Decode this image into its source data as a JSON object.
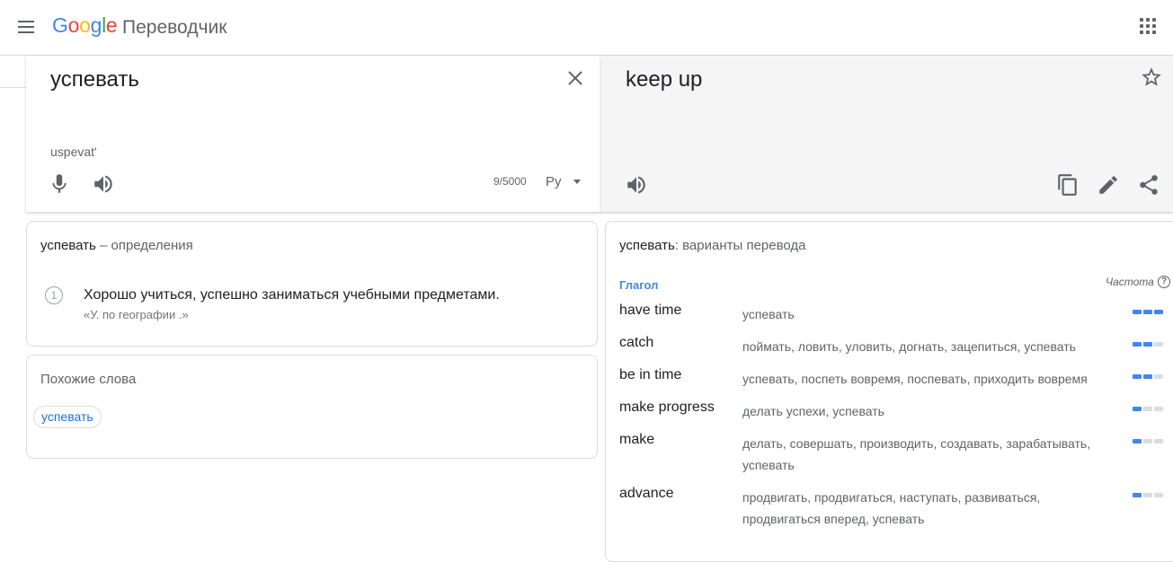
{
  "header": {
    "logo_parts": [
      "G",
      "o",
      "o",
      "g",
      "l",
      "e"
    ],
    "product": "Переводчик"
  },
  "source": {
    "text": "успевать",
    "transliteration": "uspevat'",
    "char_count": "9/5000",
    "ime_label": "Ру"
  },
  "target": {
    "text": "keep up"
  },
  "definitions": {
    "word": "успевать",
    "suffix": " – определения",
    "items": [
      {
        "number": "1",
        "text": "Хорошо учиться, успешно заниматься учебными предметами.",
        "example": "«У. по географии .»"
      }
    ]
  },
  "related": {
    "title": "Похожие слова",
    "chips": [
      "успевать"
    ]
  },
  "variants": {
    "word": "успевать",
    "suffix": ": варианты перевода",
    "pos": "Глагол",
    "frequency_label": "Частота",
    "help": "?",
    "rows": [
      {
        "word": "have time",
        "synonyms": "успевать",
        "frequency": 3
      },
      {
        "word": "catch",
        "synonyms": "поймать, ловить, уловить, догнать, зацепиться, успевать",
        "frequency": 2
      },
      {
        "word": "be in time",
        "synonyms": "успевать, поспеть вовремя, поспевать, приходить вовремя",
        "frequency": 2
      },
      {
        "word": "make progress",
        "synonyms": "делать успехи, успевать",
        "frequency": 1
      },
      {
        "word": "make",
        "synonyms": "делать, совершать, производить, создавать, зарабатывать, успевать",
        "frequency": 1
      },
      {
        "word": "advance",
        "synonyms": "продвигать, продвигаться, наступать, развиваться, продвигаться вперед, успевать",
        "frequency": 1
      }
    ]
  },
  "colors": {
    "accent": "#4285f4",
    "link": "#1a73e8",
    "target_bg": "#f5f5f5"
  },
  "icons": {
    "menu": "menu-icon",
    "apps": "apps-icon",
    "clear": "close-icon",
    "mic": "microphone-icon",
    "speaker": "speaker-icon",
    "star": "star-icon",
    "copy": "copy-icon",
    "edit": "pencil-icon",
    "share": "share-icon"
  }
}
